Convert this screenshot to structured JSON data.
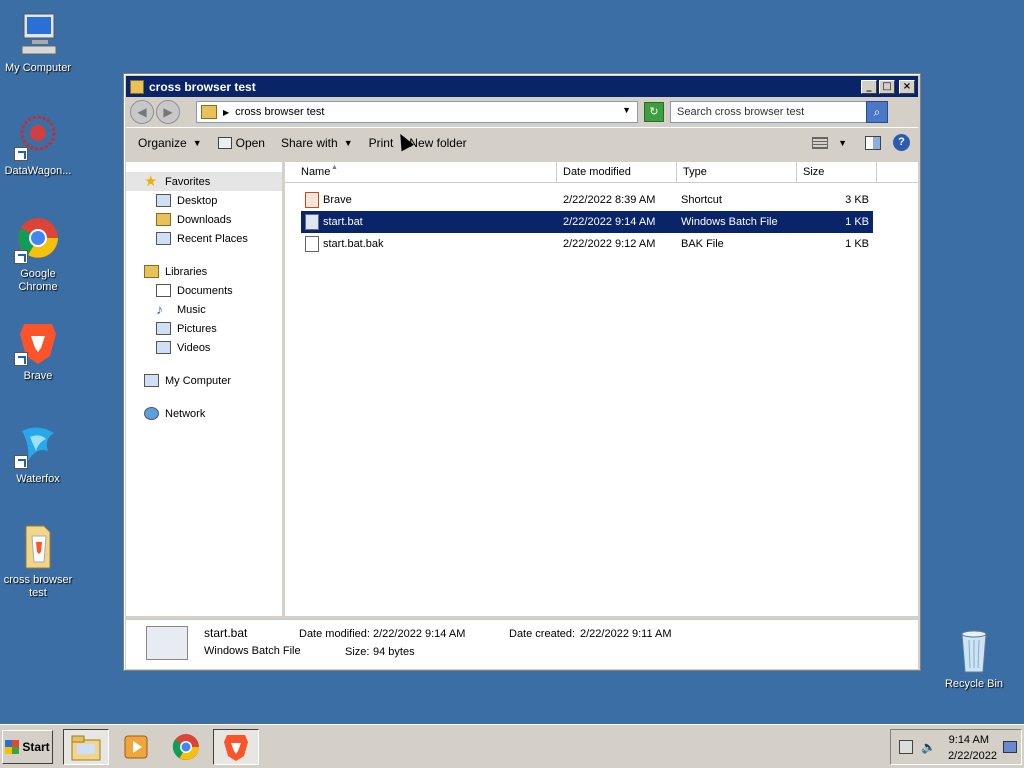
{
  "desktop": {
    "icons": [
      {
        "label": "My Computer",
        "icon": "my-computer-icon"
      },
      {
        "label": "DataWagon...",
        "icon": "datawagon-icon"
      },
      {
        "label": "Google Chrome",
        "icon": "chrome-icon"
      },
      {
        "label": "Brave",
        "icon": "brave-icon"
      },
      {
        "label": "Waterfox",
        "icon": "waterfox-icon"
      },
      {
        "label": "cross browser test",
        "icon": "folder-icon"
      },
      {
        "label": "Recycle Bin",
        "icon": "recycle-bin-icon"
      }
    ]
  },
  "window": {
    "title": "cross browser test",
    "address": "cross browser test",
    "search_placeholder": "Search cross browser test",
    "toolbar": {
      "organize": "Organize",
      "open": "Open",
      "share_with": "Share with",
      "print": "Print",
      "new_folder": "New folder"
    },
    "nav": {
      "favorites": {
        "label": "Favorites",
        "items": [
          "Desktop",
          "Downloads",
          "Recent Places"
        ]
      },
      "libraries": {
        "label": "Libraries",
        "items": [
          "Documents",
          "Music",
          "Pictures",
          "Videos"
        ]
      },
      "computer": "My Computer",
      "network": "Network"
    },
    "columns": [
      "Name",
      "Date modified",
      "Type",
      "Size"
    ],
    "files": [
      {
        "name": "Brave",
        "date": "2/22/2022 8:39 AM",
        "type": "Shortcut",
        "size": "3 KB",
        "selected": false
      },
      {
        "name": "start.bat",
        "date": "2/22/2022 9:14 AM",
        "type": "Windows Batch File",
        "size": "1 KB",
        "selected": true
      },
      {
        "name": "start.bat.bak",
        "date": "2/22/2022 9:12 AM",
        "type": "BAK File",
        "size": "1 KB",
        "selected": false
      }
    ],
    "details": {
      "name": "start.bat",
      "type": "Windows Batch File",
      "modified_label": "Date modified:",
      "modified_value": "2/22/2022 9:14 AM",
      "size_label": "Size:",
      "size_value": "94 bytes",
      "created_label": "Date created:",
      "created_value": "2/22/2022 9:11 AM"
    }
  },
  "taskbar": {
    "start_label": "Start",
    "time": "9:14 AM",
    "date": "2/22/2022"
  }
}
